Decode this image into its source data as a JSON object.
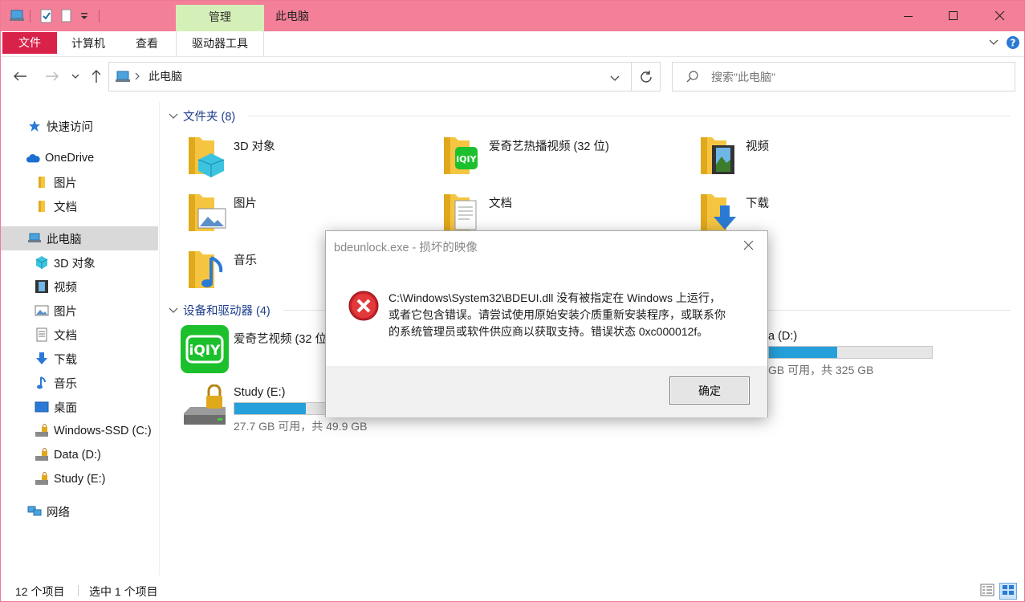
{
  "window": {
    "title": "此电脑",
    "context_tab": "管理",
    "colors": {
      "titlebar": "#f47f98",
      "file_tab": "#d9224a",
      "manage_tab": "#d4efb8",
      "accent": "#26a0da"
    }
  },
  "ribbon": {
    "file_label": "文件",
    "tabs": [
      "计算机",
      "查看"
    ],
    "drive_tools_label": "驱动器工具"
  },
  "address": {
    "path_label": "此电脑",
    "search_placeholder": "搜索\"此电脑\""
  },
  "sidebar": {
    "quick_access": "快速访问",
    "onedrive": "OneDrive",
    "onedrive_items": [
      "图片",
      "文档"
    ],
    "this_pc": "此电脑",
    "this_pc_items": [
      "3D 对象",
      "视频",
      "图片",
      "文档",
      "下载",
      "音乐",
      "桌面",
      "Windows-SSD (C:)",
      "Data (D:)",
      "Study (E:)"
    ],
    "network": "网络"
  },
  "folders_group": {
    "header": "文件夹 (8)",
    "items": [
      "3D 对象",
      "爱奇艺热播视频 (32 位)",
      "视频",
      "图片",
      "文档",
      "下载",
      "音乐"
    ]
  },
  "drives_group": {
    "header": "设备和驱动器 (4)",
    "iqiyi_label": "爱奇艺视频 (32 位",
    "data_drive": {
      "name": "a (D:)",
      "free": "GB 可用，共 325 GB",
      "used_fraction": 0.42
    },
    "study_drive": {
      "name": "Study (E:)",
      "free": "27.7 GB 可用，共 49.9 GB",
      "used_fraction": 0.44
    }
  },
  "status": {
    "count": "12 个项目",
    "selected": "选中 1 个项目"
  },
  "dialog": {
    "title": "bdeunlock.exe - 损坏的映像",
    "message_line1": "C:\\Windows\\System32\\BDEUI.dll 没有被指定在 Windows 上运行，",
    "message_line2": "或者它包含错误。请尝试使用原始安装介质重新安装程序，或联系你",
    "message_line3": "的系统管理员或软件供应商以获取支持。错误状态 0xc000012f。",
    "ok_label": "确定"
  }
}
